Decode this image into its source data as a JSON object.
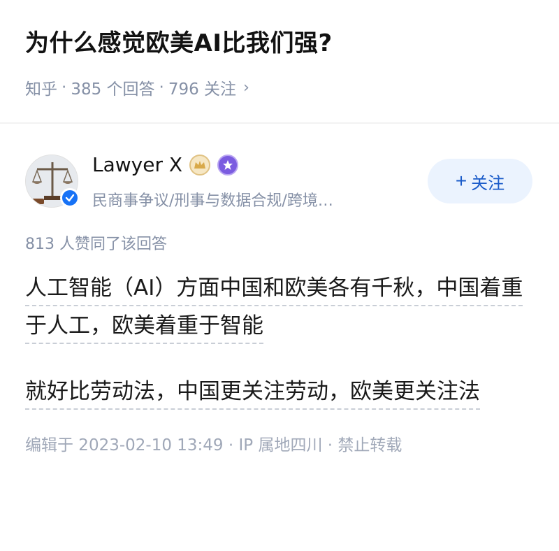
{
  "question": {
    "title": "为什么感觉欧美AI比我们强?",
    "source": "知乎",
    "answers": "385 个回答",
    "followers": "796 关注",
    "sep": "·",
    "chevron": "›"
  },
  "author": {
    "name": "Lawyer X",
    "description": "民商事争议/刑事与数据合规/跨境…",
    "follow_label": "关注",
    "follow_plus": "+"
  },
  "answer": {
    "votes": "813 人赞同了该回答",
    "paragraphs": [
      "人工智能（AI）方面中国和欧美各有千秋，中国着重于人工，欧美着重于智能",
      "就好比劳动法，中国更关注劳动，欧美更关注法"
    ],
    "edit_info": "编辑于 2023-02-10 13:49 · IP 属地四川 · 禁止转载"
  },
  "colors": {
    "accent": "#1772f6",
    "follow_bg": "#ebf3fe",
    "meta": "#8590a6"
  },
  "icons": [
    "scales-avatar",
    "verified-check-icon",
    "crown-badge-icon",
    "star-badge-icon",
    "chevron-right-icon",
    "plus-icon"
  ]
}
